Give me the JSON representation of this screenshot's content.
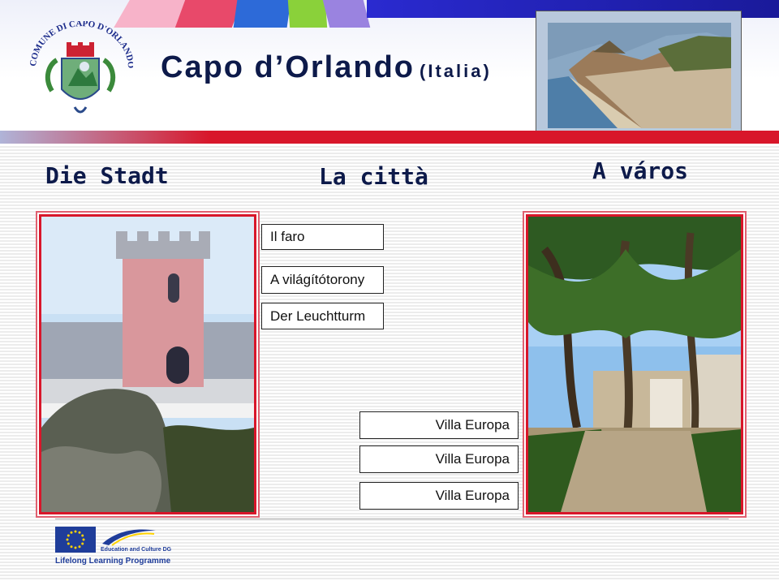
{
  "title": {
    "main": "Capo d’Orlando",
    "sub": "(Italia)"
  },
  "coat_of_arms": {
    "text": "COMUNE DI CAPO D'ORLANDO"
  },
  "headings": {
    "de": "Die Stadt",
    "it": "La città",
    "hu": "A város"
  },
  "lighthouse_labels": [
    "Il faro",
    "A világítótorony",
    "Der Leuchtturm"
  ],
  "villa_labels": [
    "Villa Europa",
    "Villa Europa",
    "Villa Europa"
  ],
  "footer": {
    "programme": "Lifelong Learning Programme",
    "dg": "Education and Culture DG"
  },
  "colors": {
    "accent_red": "#d8162a",
    "title_navy": "#0d1a4a",
    "eu_blue": "#1f3d9a",
    "eu_star": "#ffd200"
  }
}
